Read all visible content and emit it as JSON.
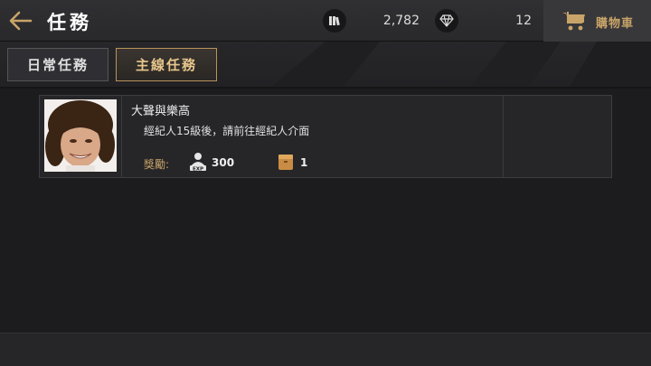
{
  "header": {
    "title": "任務",
    "back_icon": "arrow-left-icon",
    "currency_1": {
      "icon": "books-icon",
      "value": "2,782"
    },
    "currency_2": {
      "icon": "diamond-icon",
      "value": "12"
    },
    "cart": {
      "icon": "cart-icon",
      "label": "購物車"
    }
  },
  "tabs": [
    {
      "label": "日常任務",
      "selected": false
    },
    {
      "label": "主線任務",
      "selected": true
    }
  ],
  "quest": {
    "title": "大聲與樂高",
    "description": "經紀人15級後，請前往經紀人介面",
    "reward_label": "獎勵:",
    "rewards": [
      {
        "icon": "exp-icon",
        "value": "300"
      },
      {
        "icon": "box-icon",
        "value": "1"
      }
    ]
  },
  "colors": {
    "accent": "#c9a468",
    "background": "#1c1c1f"
  }
}
